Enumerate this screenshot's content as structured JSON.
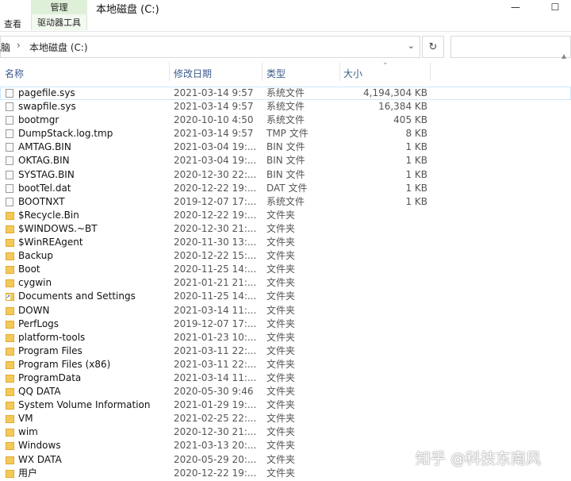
{
  "ribbon": {
    "context_tab_top": "管理",
    "context_tab_bottom": "驱动器工具",
    "view_tab": "查看",
    "window_title": "本地磁盘 (C:)",
    "minimize": "—",
    "maximize": "☐"
  },
  "address": {
    "crumb_prev": "电脑",
    "separator": "›",
    "crumb_current": "本地磁盘 (C:)",
    "dropdown": "⌄",
    "refresh": "↻",
    "search_placeholder": ""
  },
  "columns": {
    "name": "名称",
    "date": "修改日期",
    "type": "类型",
    "size": "大小",
    "sort_indicator": "⌄"
  },
  "files": [
    {
      "name": "pagefile.sys",
      "date": "2021-03-14 9:57",
      "type": "系统文件",
      "size": "4,194,304 KB",
      "icon": "file"
    },
    {
      "name": "swapfile.sys",
      "date": "2021-03-14 9:57",
      "type": "系统文件",
      "size": "16,384 KB",
      "icon": "file"
    },
    {
      "name": "bootmgr",
      "date": "2020-10-10 4:50",
      "type": "系统文件",
      "size": "405 KB",
      "icon": "file"
    },
    {
      "name": "DumpStack.log.tmp",
      "date": "2021-03-14 9:57",
      "type": "TMP 文件",
      "size": "8 KB",
      "icon": "file"
    },
    {
      "name": "AMTAG.BIN",
      "date": "2021-03-04 19:...",
      "type": "BIN 文件",
      "size": "1 KB",
      "icon": "file"
    },
    {
      "name": "OKTAG.BIN",
      "date": "2021-03-04 19:...",
      "type": "BIN 文件",
      "size": "1 KB",
      "icon": "file"
    },
    {
      "name": "SYSTAG.BIN",
      "date": "2020-12-30 22:...",
      "type": "BIN 文件",
      "size": "1 KB",
      "icon": "file"
    },
    {
      "name": "bootTel.dat",
      "date": "2020-12-22 19:...",
      "type": "DAT 文件",
      "size": "1 KB",
      "icon": "file"
    },
    {
      "name": "BOOTNXT",
      "date": "2019-12-07 17:...",
      "type": "系统文件",
      "size": "1 KB",
      "icon": "file"
    },
    {
      "name": "$Recycle.Bin",
      "date": "2020-12-22 19:...",
      "type": "文件夹",
      "size": "",
      "icon": "folder"
    },
    {
      "name": "$WINDOWS.~BT",
      "date": "2020-12-30 21:...",
      "type": "文件夹",
      "size": "",
      "icon": "folder"
    },
    {
      "name": "$WinREAgent",
      "date": "2020-11-30 13:...",
      "type": "文件夹",
      "size": "",
      "icon": "folder"
    },
    {
      "name": "Backup",
      "date": "2020-12-22 15:...",
      "type": "文件夹",
      "size": "",
      "icon": "folder"
    },
    {
      "name": "Boot",
      "date": "2020-11-25 14:...",
      "type": "文件夹",
      "size": "",
      "icon": "folder"
    },
    {
      "name": "cygwin",
      "date": "2021-01-21 21:...",
      "type": "文件夹",
      "size": "",
      "icon": "folder"
    },
    {
      "name": "Documents and Settings",
      "date": "2020-11-25 14:...",
      "type": "文件夹",
      "size": "",
      "icon": "fold-lnk"
    },
    {
      "name": "DOWN",
      "date": "2021-03-14 11:...",
      "type": "文件夹",
      "size": "",
      "icon": "folder"
    },
    {
      "name": "PerfLogs",
      "date": "2019-12-07 17:...",
      "type": "文件夹",
      "size": "",
      "icon": "folder"
    },
    {
      "name": "platform-tools",
      "date": "2021-01-23 10:...",
      "type": "文件夹",
      "size": "",
      "icon": "folder"
    },
    {
      "name": "Program Files",
      "date": "2021-03-11 22:...",
      "type": "文件夹",
      "size": "",
      "icon": "folder"
    },
    {
      "name": "Program Files (x86)",
      "date": "2021-03-11 22:...",
      "type": "文件夹",
      "size": "",
      "icon": "folder"
    },
    {
      "name": "ProgramData",
      "date": "2021-03-14 11:...",
      "type": "文件夹",
      "size": "",
      "icon": "folder"
    },
    {
      "name": "QQ DATA",
      "date": "2020-05-30 9:46",
      "type": "文件夹",
      "size": "",
      "icon": "folder"
    },
    {
      "name": "System Volume Information",
      "date": "2021-01-29 19:...",
      "type": "文件夹",
      "size": "",
      "icon": "folder"
    },
    {
      "name": "VM",
      "date": "2021-02-25 22:...",
      "type": "文件夹",
      "size": "",
      "icon": "folder"
    },
    {
      "name": "wim",
      "date": "2020-12-30 21:...",
      "type": "文件夹",
      "size": "",
      "icon": "folder"
    },
    {
      "name": "Windows",
      "date": "2021-03-13 20:...",
      "type": "文件夹",
      "size": "",
      "icon": "folder"
    },
    {
      "name": "WX DATA",
      "date": "2020-05-29 20:...",
      "type": "文件夹",
      "size": "",
      "icon": "folder"
    },
    {
      "name": "用户",
      "date": "2020-12-22 19:...",
      "type": "文件夹",
      "size": "",
      "icon": "folder"
    }
  ],
  "watermark": "知乎 @科技东南风"
}
